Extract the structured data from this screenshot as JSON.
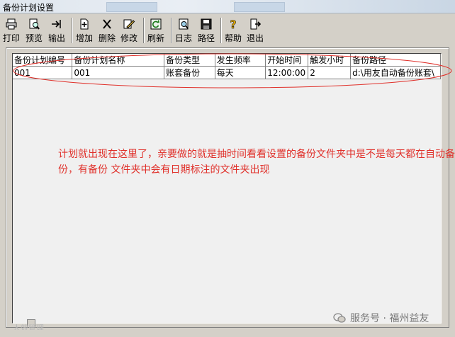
{
  "window": {
    "title": "备份计划设置"
  },
  "toolbar": {
    "buttons": [
      {
        "label": "打印",
        "icon": "printer-icon"
      },
      {
        "label": "预览",
        "icon": "preview-icon"
      },
      {
        "label": "输出",
        "icon": "export-icon"
      },
      {
        "label": "增加",
        "icon": "add-icon"
      },
      {
        "label": "删除",
        "icon": "delete-icon"
      },
      {
        "label": "修改",
        "icon": "edit-icon"
      },
      {
        "label": "刷新",
        "icon": "refresh-icon"
      },
      {
        "label": "日志",
        "icon": "log-icon"
      },
      {
        "label": "路径",
        "icon": "save-path-icon"
      },
      {
        "label": "帮助",
        "icon": "help-icon"
      },
      {
        "label": "退出",
        "icon": "exit-icon"
      }
    ]
  },
  "table": {
    "columns": [
      "备份计划编号",
      "备份计划名称",
      "备份类型",
      "发生频率",
      "开始时间",
      "触发小时",
      "备份路径"
    ],
    "rows": [
      [
        "001",
        "001",
        "账套备份",
        "每天",
        "12:00:00",
        "2",
        "d:\\用友自动备份账套\\"
      ]
    ]
  },
  "annotation": {
    "text": "计划就出现在这里了，亲要做的就是抽时间看看设置的备份文件夹中是不是每天都在自动备份，有备份 文件夹中会有日期标注的文件夹出现",
    "color": "#e0302a"
  },
  "watermark": {
    "text": "服务号 · 福州益友"
  },
  "faint_text": "人效管理"
}
